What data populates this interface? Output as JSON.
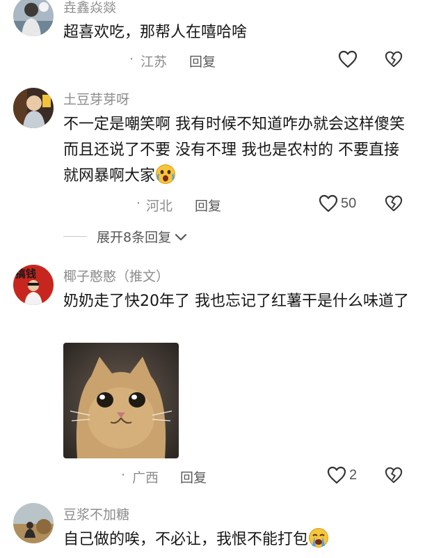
{
  "comments": [
    {
      "username": "垚鑫焱燚",
      "text": "超喜欢吃，那帮人在嘻哈啥",
      "location": "江苏",
      "reply_label": "回复",
      "likes": ""
    },
    {
      "username": "土豆芽芽呀",
      "text": "不一定是嘲笑啊 我有时候不知道咋办就会这样傻笑 而且还说了不要 没有不理 我也是农村的 不要直接就网暴啊大家",
      "location": "河北",
      "reply_label": "回复",
      "likes": "50",
      "expand_label": "展开8条回复"
    },
    {
      "username": "椰子憨憨（推文）",
      "text": "奶奶走了快20年了 我也忘记了红薯干是什么味道了",
      "location": "广西",
      "reply_label": "回复",
      "likes": "2"
    },
    {
      "username": "豆浆不加糖",
      "text": "自己做的唉，不必让，我恨不能打包",
      "location": "",
      "reply_label": "",
      "likes": ""
    }
  ],
  "meta_dot": "·",
  "avatar_sign_text": "搞钱",
  "icons": {
    "like": "heart-outline-icon",
    "dislike": "broken-heart-icon",
    "expand": "chevron-down-icon",
    "emoji_1": "crying-laughing-emoji",
    "emoji_2": "sobbing-emoji"
  },
  "colors": {
    "username": "#8c8c8c",
    "text": "#161616",
    "icon": "#333333",
    "emoji": "#f7c53a"
  }
}
